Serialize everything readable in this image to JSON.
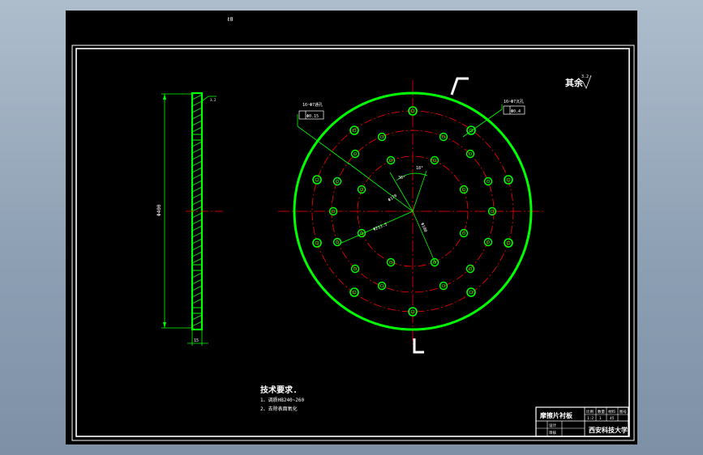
{
  "drawing": {
    "corner_mark": "ℓ0",
    "roughness_note": "其余",
    "roughness_value": "3.2",
    "requirements": {
      "title": "技术要求.",
      "items": [
        "1、调质HB240~260",
        "2、去除表面氧化"
      ]
    },
    "side_view": {
      "height_dim": "Φ400",
      "thickness_dim": "15",
      "finish_mark": "3.2"
    },
    "front_view": {
      "note_left": "16~Φ7通孔",
      "frame_left": "Φ0.15",
      "note_right": "16~Φ7沉孔",
      "frame_right": "Φ0.4",
      "dim_d1": "Φ170",
      "dim_d2": "Φ213.5",
      "dim_d3": "Φ100",
      "angle_1": "36°",
      "angle_2": "18°"
    },
    "title_block": {
      "part_name": "摩擦片衬板",
      "school": "西安科技大学",
      "labels": [
        "比例",
        "数量",
        "材料",
        "图号"
      ],
      "row2": [
        "1:2",
        "1",
        "45",
        ""
      ],
      "left_labels": [
        "设计",
        "审核"
      ]
    }
  },
  "colors": {
    "background": "#000000",
    "outline": "#00ff00",
    "centerline": "#ff0000",
    "border": "#ffffff"
  }
}
